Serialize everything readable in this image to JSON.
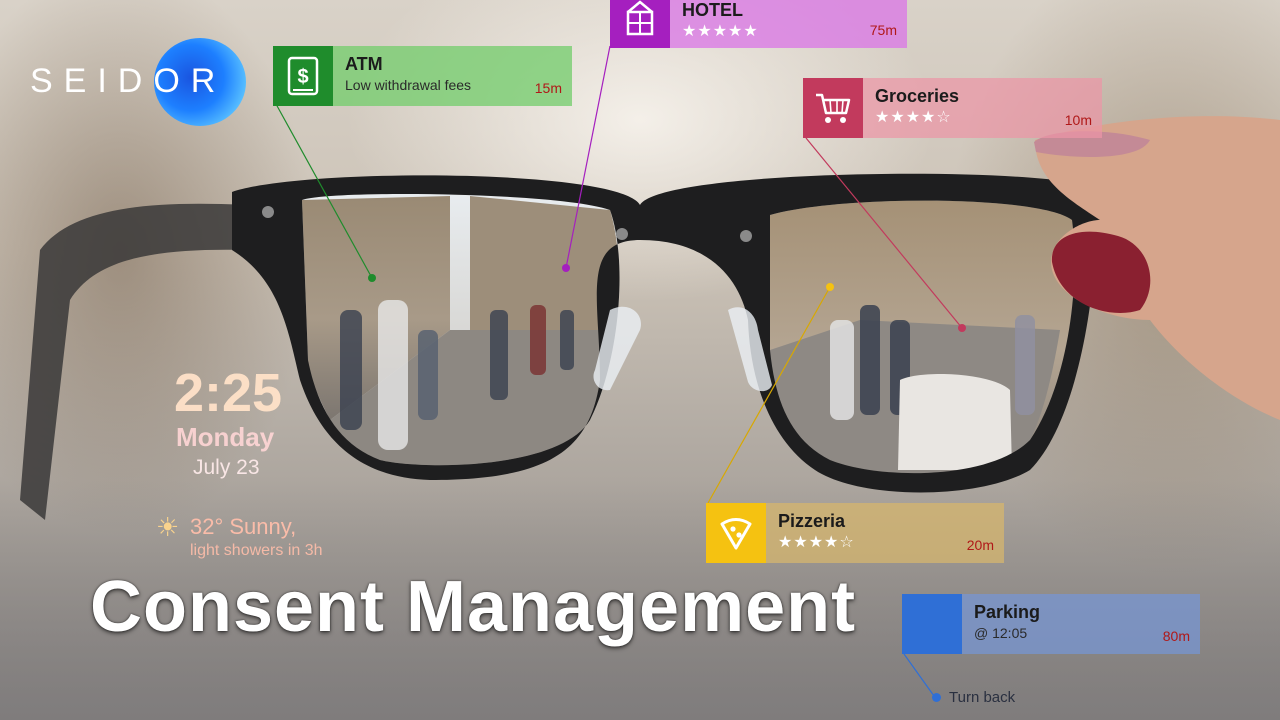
{
  "logo": {
    "text": "SEIDOR"
  },
  "headline": "Consent Management",
  "hud": {
    "time": "2:25",
    "day": "Monday",
    "date": "July 23",
    "weather_temp": "32° Sunny,",
    "weather_forecast": "light showers in 3h"
  },
  "cards": {
    "atm": {
      "title": "ATM",
      "subtitle": "Low withdrawal fees",
      "distance": "15m",
      "icon": "dollar-bill-icon"
    },
    "hotel": {
      "title": "HOTEL",
      "stars": "★★★★★",
      "rating": 5,
      "distance": "75m",
      "icon": "building-icon"
    },
    "groceries": {
      "title": "Groceries",
      "stars": "★★★★☆",
      "rating": 4,
      "distance": "10m",
      "icon": "shopping-cart-icon"
    },
    "pizzeria": {
      "title": "Pizzeria",
      "stars": "★★★★☆",
      "rating": 4,
      "distance": "20m",
      "icon": "pizza-icon"
    },
    "parking": {
      "title": "Parking",
      "subtitle": "@ 12:05",
      "distance": "80m",
      "icon": "parking-icon"
    }
  },
  "nav": {
    "turn_text": "Turn back"
  },
  "colors": {
    "atm": "#1f8c2c",
    "hotel": "#a51fbf",
    "groceries": "#c23a5d",
    "pizzeria": "#f5c211",
    "parking": "#2f6fd6",
    "brand_blue": "#1d7fff"
  }
}
